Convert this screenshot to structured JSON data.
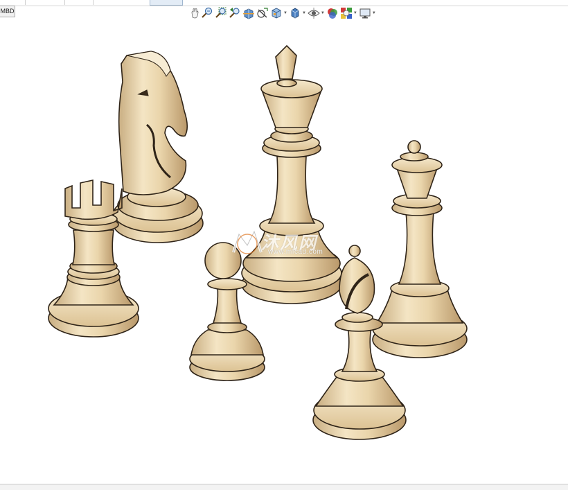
{
  "app": {
    "mbd_tab_label": "MBD"
  },
  "heads_up_toolbar": {
    "tools": [
      {
        "icon": "hand-icon",
        "has_dropdown": false
      },
      {
        "icon": "zoom-to-fit-icon",
        "has_dropdown": false
      },
      {
        "icon": "zoom-to-area-icon",
        "has_dropdown": false
      },
      {
        "icon": "previous-view-icon",
        "has_dropdown": false
      },
      {
        "icon": "section-view-icon",
        "has_dropdown": false
      },
      {
        "icon": "dynamic-annotation-icon",
        "has_dropdown": false
      },
      {
        "icon": "view-orientation-icon",
        "has_dropdown": true
      },
      {
        "icon": "display-style-icon",
        "has_dropdown": true
      },
      {
        "icon": "hide-show-items-icon",
        "has_dropdown": true
      },
      {
        "icon": "edit-appearance-icon",
        "has_dropdown": false
      },
      {
        "icon": "apply-scene-icon",
        "has_dropdown": true
      },
      {
        "icon": "view-settings-icon",
        "has_dropdown": true
      }
    ]
  },
  "model": {
    "pieces": [
      {
        "name": "knight"
      },
      {
        "name": "rook"
      },
      {
        "name": "king"
      },
      {
        "name": "pawn"
      },
      {
        "name": "bishop"
      },
      {
        "name": "queen"
      }
    ],
    "wood_color": "#ecd9b1",
    "outline_color": "#2f2418"
  },
  "watermark": {
    "main_text": "沐风网",
    "sub_text": "www.mfcad.com"
  }
}
